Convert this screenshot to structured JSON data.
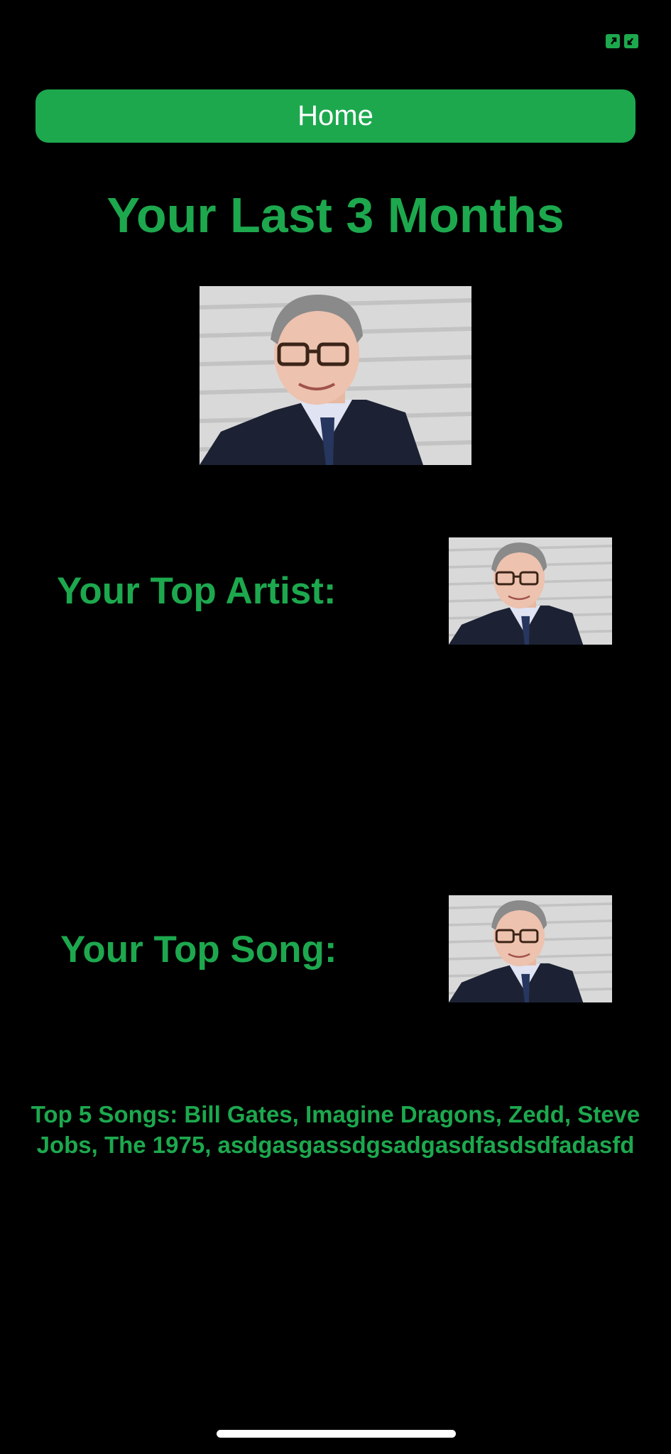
{
  "header": {
    "home_label": "Home"
  },
  "page": {
    "title": "Your Last 3 Months"
  },
  "top_artist": {
    "label": "Your Top Artist:"
  },
  "top_song": {
    "label": "Your Top Song:"
  },
  "top5": {
    "text": "Top 5 Songs: Bill Gates, Imagine Dragons, Zedd, Steve Jobs, The 1975, asdgasgassdgsadgasdfasdsdfadasfd"
  },
  "icons": {
    "expand": "expand-icon"
  },
  "colors": {
    "accent": "#1DA84E",
    "background": "#000000",
    "home_text": "#FFFFFF"
  }
}
